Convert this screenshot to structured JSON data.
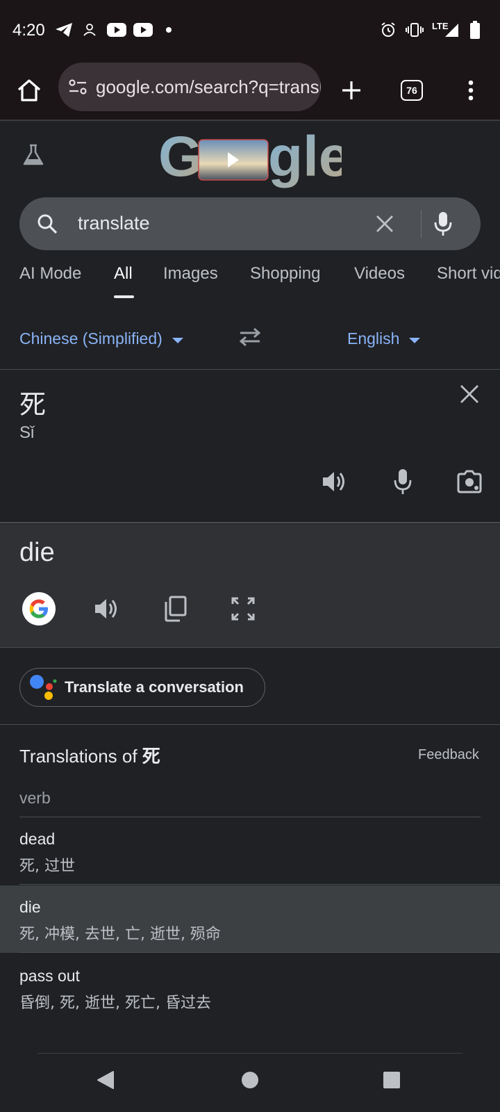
{
  "status_bar": {
    "time": "4:20",
    "network": "LTE"
  },
  "browser": {
    "url": "google.com/search?q=translate",
    "tab_count": "76"
  },
  "search": {
    "query": "translate"
  },
  "nav_tabs": [
    "AI Mode",
    "All",
    "Images",
    "Shopping",
    "Videos",
    "Short videos"
  ],
  "active_tab": "All",
  "translate": {
    "source_lang": "Chinese (Simplified)",
    "target_lang": "English",
    "source_text": "死",
    "pinyin": "Sǐ",
    "result": "die",
    "conversation_label": "Translate a conversation",
    "translations_heading": "Translations of",
    "translations_word": "死",
    "feedback": "Feedback",
    "part_of_speech": "verb",
    "entries": [
      {
        "word": "dead",
        "synonyms": "死, 过世"
      },
      {
        "word": "die",
        "synonyms": "死, 冲模, 去世, 亡, 逝世, 殒命"
      },
      {
        "word": "pass out",
        "synonyms": "昏倒, 死, 逝世, 死亡, 昏过去"
      }
    ]
  },
  "colors": {
    "accent_blue": "#8ab4f8",
    "background": "#202124",
    "highlight_row": "#3c4043"
  }
}
